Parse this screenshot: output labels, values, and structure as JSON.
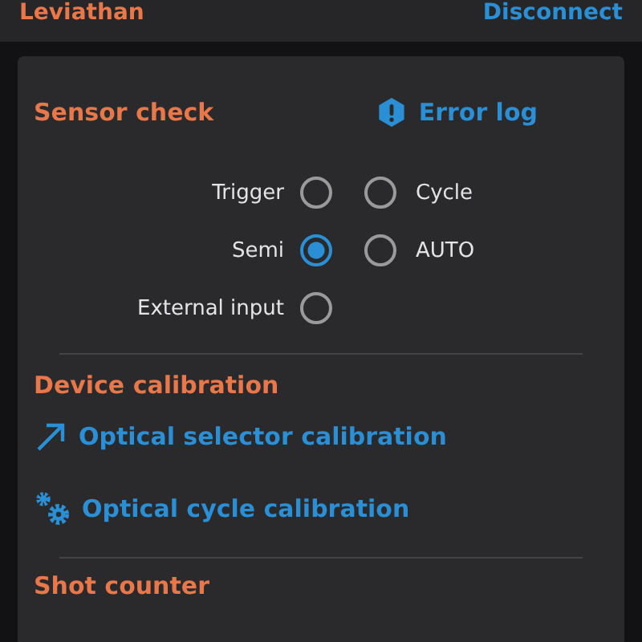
{
  "header": {
    "title": "Leviathan",
    "action": "Disconnect"
  },
  "sensor_check": {
    "title": "Sensor check",
    "error_log": "Error log",
    "rows": [
      {
        "left": {
          "label": "Trigger",
          "selected": false
        },
        "right": {
          "label": "Cycle",
          "selected": false
        }
      },
      {
        "left": {
          "label": "Semi",
          "selected": true
        },
        "right": {
          "label": "AUTO",
          "selected": false
        }
      },
      {
        "left": {
          "label": "External input",
          "selected": false
        }
      }
    ]
  },
  "device_calibration": {
    "title": "Device calibration",
    "links": [
      {
        "kind": "arrow",
        "label": "Optical selector calibration"
      },
      {
        "kind": "gears",
        "label": "Optical cycle calibration"
      }
    ]
  },
  "shot_counter": {
    "title": "Shot counter"
  }
}
